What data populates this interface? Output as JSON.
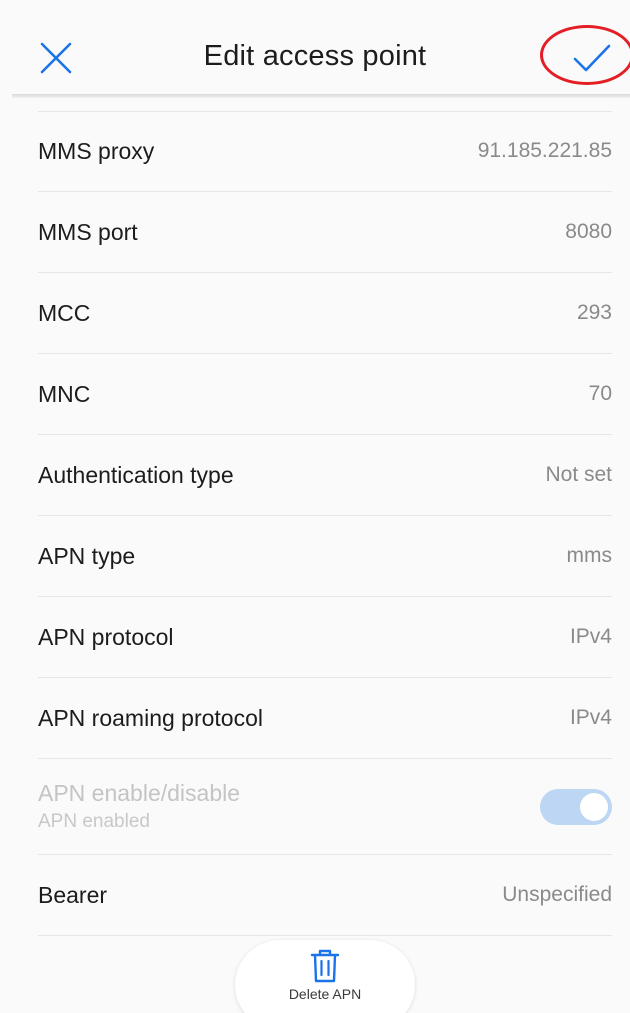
{
  "header": {
    "title": "Edit access point",
    "close_icon": "close-icon",
    "confirm_icon": "checkmark-icon",
    "accent_color": "#1a73e8",
    "annotation_color": "#e31e24"
  },
  "rows": [
    {
      "label": "MMS proxy",
      "value": "91.185.221.85"
    },
    {
      "label": "MMS port",
      "value": "8080"
    },
    {
      "label": "MCC",
      "value": "293"
    },
    {
      "label": "MNC",
      "value": "70"
    },
    {
      "label": "Authentication type",
      "value": "Not set"
    },
    {
      "label": "APN type",
      "value": "mms"
    },
    {
      "label": "APN protocol",
      "value": "IPv4"
    },
    {
      "label": "APN roaming protocol",
      "value": "IPv4"
    }
  ],
  "apn_toggle": {
    "label": "APN enable/disable",
    "sublabel": "APN enabled",
    "enabled": true
  },
  "bearer": {
    "label": "Bearer",
    "value": "Unspecified"
  },
  "delete": {
    "label": "Delete APN",
    "icon": "trash-icon"
  }
}
